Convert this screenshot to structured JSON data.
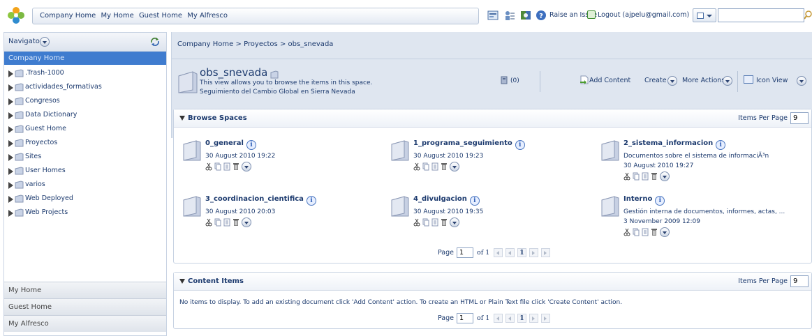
{
  "topbar": {
    "links": [
      "Company Home",
      "My Home",
      "Guest Home",
      "My Alfresco"
    ],
    "raise_issue": "Raise an Issue",
    "logout": "Logout (ajpelu@gmail.com)",
    "search_value": "",
    "icons": [
      "admin-console-icon",
      "user-profile-icon",
      "help-icon"
    ]
  },
  "navigator": {
    "label": "Navigator",
    "current": "Company Home",
    "items": [
      {
        "label": ".Trash-1000"
      },
      {
        "label": "actividades_formativas"
      },
      {
        "label": "Congresos"
      },
      {
        "label": "Data Dictionary"
      },
      {
        "label": "Guest Home"
      },
      {
        "label": "Proyectos"
      },
      {
        "label": "Sites"
      },
      {
        "label": "User Homes"
      },
      {
        "label": "varios"
      },
      {
        "label": "Web Deployed"
      },
      {
        "label": "Web Projects"
      }
    ],
    "bottom": [
      "My Home",
      "Guest Home",
      "My Alfresco"
    ]
  },
  "breadcrumb": [
    "Company Home",
    ">",
    "Proyectos",
    ">",
    "obs_snevada"
  ],
  "space": {
    "title": "obs_snevada",
    "desc1": "This view allows you to browse the items in this space.",
    "desc2": "Seguimiento del Cambio Global en Sierra Nevada",
    "rules_count": "(0)",
    "add_content": "Add Content",
    "create": "Create",
    "more_actions": "More Actions",
    "view": "Icon View"
  },
  "browse": {
    "title": "Browse Spaces",
    "items_per_page_label": "Items Per Page",
    "items_per_page": "9",
    "spaces": [
      {
        "name": "0_general",
        "line1": "30 August 2010 19:22",
        "line2": ""
      },
      {
        "name": "1_programa_seguimiento",
        "line1": "30 August 2010 19:23",
        "line2": ""
      },
      {
        "name": "2_sistema_informacion",
        "line1": "Documentos sobre el sistema de informaciÃ³n",
        "line2": "30 August 2010 19:27"
      },
      {
        "name": "3_coordinacion_cientifica",
        "line1": "30 August 2010 20:03",
        "line2": ""
      },
      {
        "name": "4_divulgacion",
        "line1": "30 August 2010 19:35",
        "line2": ""
      },
      {
        "name": "Interno",
        "line1": "Gestión interna de documentos, informes, actas, ...",
        "line2": "3 November 2009 12:09"
      }
    ],
    "pager": {
      "label": "Page",
      "page": "1",
      "of": "of 1",
      "current": "1"
    }
  },
  "content": {
    "title": "Content Items",
    "items_per_page_label": "Items Per Page",
    "items_per_page": "9",
    "empty_message": "No items to display. To add an existing document click 'Add Content' action. To create an HTML or Plain Text file click 'Create Content' action.",
    "pager": {
      "label": "Page",
      "page": "1",
      "of": "of 1",
      "current": "1"
    }
  },
  "colors": {
    "accent": "#3f7ccf",
    "text": "#1c3a6e",
    "header_bg": "#dfe6f0"
  }
}
